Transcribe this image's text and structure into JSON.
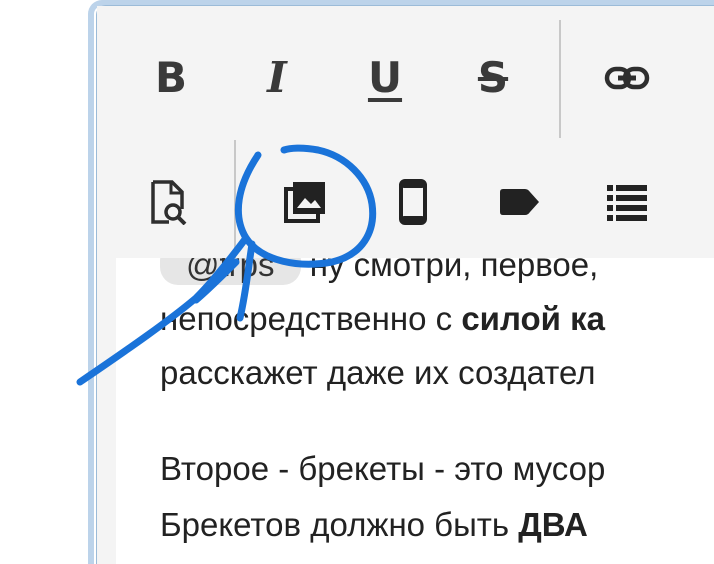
{
  "toolbar": {
    "row1": [
      {
        "name": "bold-button",
        "icon": "bold-icon",
        "glyph": "B"
      },
      {
        "name": "italic-button",
        "icon": "italic-icon",
        "glyph": "I"
      },
      {
        "name": "underline-button",
        "icon": "underline-icon",
        "glyph": "U"
      },
      {
        "name": "strikethrough-button",
        "icon": "strikethrough-icon",
        "glyph": "S"
      },
      {
        "name": "link-button",
        "icon": "link-icon",
        "glyph": ""
      }
    ],
    "row2": [
      {
        "name": "preview-button",
        "icon": "search-document-icon"
      },
      {
        "name": "gallery-button",
        "icon": "image-gallery-icon"
      },
      {
        "name": "mobile-button",
        "icon": "mobile-phone-icon"
      },
      {
        "name": "tag-button",
        "icon": "tag-icon"
      },
      {
        "name": "list-button",
        "icon": "list-icon"
      }
    ]
  },
  "content": {
    "line1": {
      "mention": "@trps",
      "text": "ну смотри, первое,"
    },
    "line2": {
      "before": "непосредственно с ",
      "bold": "силой ка"
    },
    "line3": {
      "text": "расскажет даже их создател"
    },
    "line4": {
      "text": "Второе - брекеты - это мусор"
    },
    "line5": {
      "before": "Брекетов должно быть ",
      "bold": "ДВА"
    }
  },
  "colors": {
    "frame_border": "#bcd3ea",
    "toolbar_bg": "#f4f4f4",
    "annotation": "#1a73d9",
    "text": "#222222"
  }
}
